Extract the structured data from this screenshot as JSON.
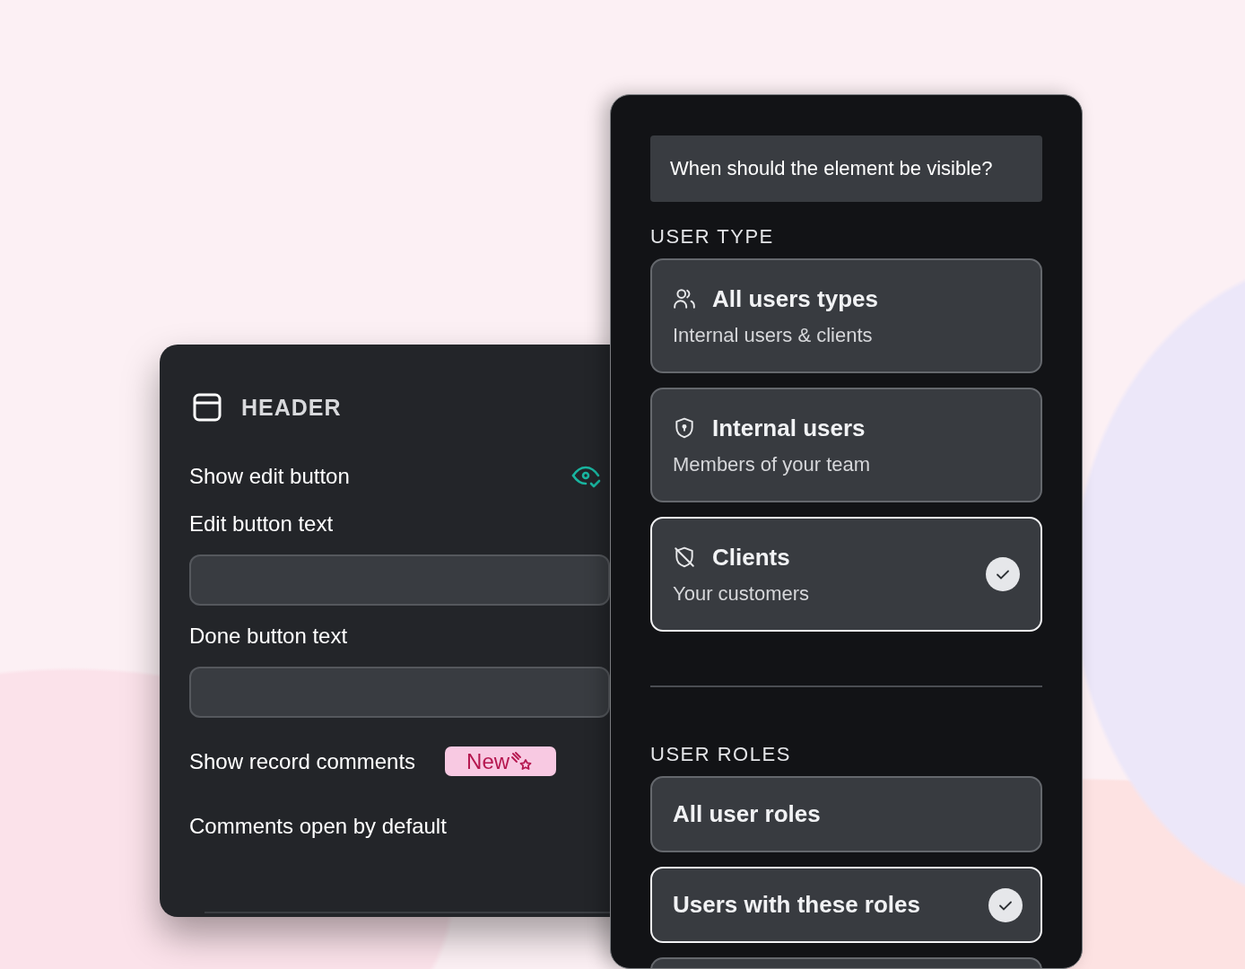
{
  "settings_panel": {
    "title": "HEADER",
    "rows": [
      {
        "kind": "toggle",
        "label": "Show edit button",
        "visible": true
      },
      {
        "kind": "field",
        "label": "Edit button text"
      },
      {
        "kind": "field",
        "label": "Done button text"
      },
      {
        "kind": "badge",
        "label": "Show record comments",
        "badge": "New"
      },
      {
        "kind": "plain",
        "label": "Comments open by default"
      }
    ]
  },
  "visibility_panel": {
    "question": "When should the element be visible?",
    "user_type": {
      "heading": "USER TYPE",
      "options": [
        {
          "kind": "users",
          "title": "All users types",
          "subtitle": "Internal users & clients",
          "selected": false
        },
        {
          "kind": "shield",
          "title": "Internal users",
          "subtitle": "Members of your team",
          "selected": false
        },
        {
          "kind": "shield-off",
          "title": "Clients",
          "subtitle": "Your customers",
          "selected": true
        }
      ]
    },
    "user_roles": {
      "heading": "USER ROLES",
      "options": [
        {
          "title": "All user roles",
          "selected": false
        },
        {
          "title": "Users with these roles",
          "selected": true
        },
        {
          "selected": false
        }
      ]
    }
  }
}
